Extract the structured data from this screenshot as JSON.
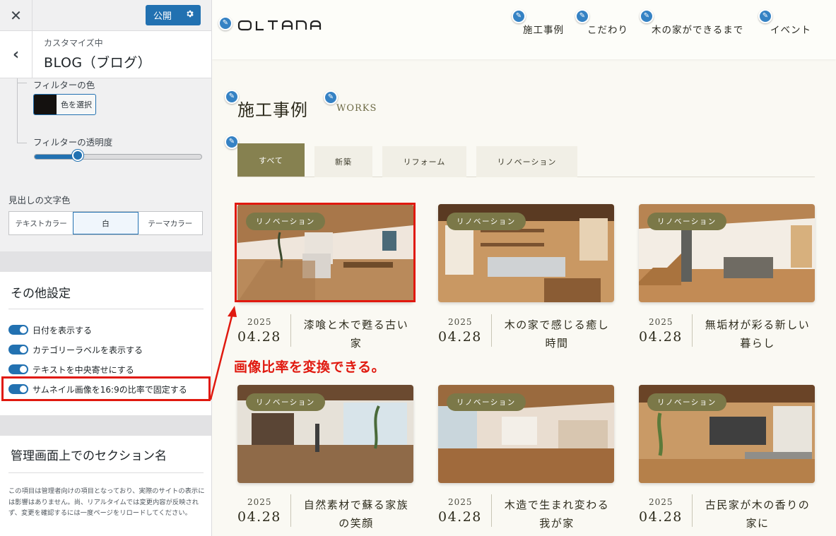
{
  "customizer": {
    "close_glyph": "✕",
    "publish_label": "公開",
    "back_glyph": "‹",
    "breadcrumb_sub": "カスタマイズ中",
    "breadcrumb_title": "BLOG（ブログ）",
    "filter_color_label": "フィルターの色",
    "select_color_label": "色を選択",
    "filter_color_value": "#14110f",
    "filter_opacity_label": "フィルターの透明度",
    "filter_opacity_value": 0.26,
    "heading_color_label": "見出しの文字色",
    "heading_color_options": [
      "テキストカラー",
      "白",
      "テーマカラー"
    ],
    "heading_color_selected": "白",
    "other_settings_title": "その他設定",
    "toggles": [
      {
        "label": "日付を表示する",
        "on": true
      },
      {
        "label": "カテゴリーラベルを表示する",
        "on": true
      },
      {
        "label": "テキストを中央寄せにする",
        "on": true
      },
      {
        "label": "サムネイル画像を16:9の比率で固定する",
        "on": true
      }
    ],
    "admin_section_title": "管理画面上でのセクション名",
    "admin_section_note": "この項目は管理者向けの項目となっており、実際のサイトの表示には影響はありません。尚、リアルタイムでは変更内容が反映されず、変更を確認するには一度ページをリロードしてください。",
    "accent_color": "#2271b1"
  },
  "site": {
    "logo": "OLTANA",
    "nav": [
      "施工事例",
      "こだわり",
      "木の家ができるまで",
      "イベント"
    ],
    "section_title": "施工事例",
    "section_subtitle": "WORKS",
    "tabs": [
      "すべて",
      "新築",
      "リフォーム",
      "リノベーション"
    ],
    "active_tab": "すべて",
    "accent_color": "#868150",
    "annotation": "画像比率を変換できる。",
    "annotation_color": "#e0190f",
    "posts": [
      {
        "badge": "リノベーション",
        "year": "2025",
        "day": "04.28",
        "title": "漆喰と木で甦る古い家"
      },
      {
        "badge": "リノベーション",
        "year": "2025",
        "day": "04.28",
        "title": "木の家で感じる癒し時間"
      },
      {
        "badge": "リノベーション",
        "year": "2025",
        "day": "04.28",
        "title": "無垢材が彩る新しい暮らし"
      },
      {
        "badge": "リノベーション",
        "year": "2025",
        "day": "04.28",
        "title": "自然素材で蘇る家族の笑顔"
      },
      {
        "badge": "リノベーション",
        "year": "2025",
        "day": "04.28",
        "title": "木造で生まれ変わる我が家"
      },
      {
        "badge": "リノベーション",
        "year": "2025",
        "day": "04.28",
        "title": "古民家が木の香りの家に"
      }
    ]
  }
}
